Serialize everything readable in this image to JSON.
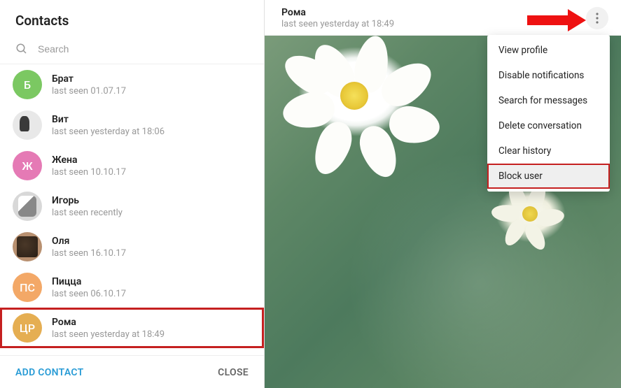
{
  "sidebar": {
    "title": "Contacts",
    "search_placeholder": "Search",
    "contacts": [
      {
        "name": "Брат",
        "status": "last seen 01.07.17",
        "avatar_letter": "Б",
        "avatar_class": "avatar-b"
      },
      {
        "name": "Вит",
        "status": "last seen yesterday at 18:06",
        "avatar_letter": "",
        "avatar_class": "avatar-vit"
      },
      {
        "name": "Жена",
        "status": "last seen 10.10.17",
        "avatar_letter": "Ж",
        "avatar_class": "avatar-zh"
      },
      {
        "name": "Игорь",
        "status": "last seen recently",
        "avatar_letter": "",
        "avatar_class": "avatar-igor"
      },
      {
        "name": "Оля",
        "status": "last seen 16.10.17",
        "avatar_letter": "",
        "avatar_class": "avatar-olya"
      },
      {
        "name": "Пицца",
        "status": "last seen 06.10.17",
        "avatar_letter": "ПС",
        "avatar_class": "avatar-pc"
      },
      {
        "name": "Рома",
        "status": "last seen yesterday at 18:49",
        "avatar_letter": "ЦР",
        "avatar_class": "avatar-cr",
        "highlighted": true
      }
    ],
    "add_contact_label": "ADD CONTACT",
    "close_label": "CLOSE"
  },
  "chat": {
    "title": "Рома",
    "status": "last seen yesterday at 18:49"
  },
  "menu": {
    "items": [
      {
        "label": "View profile"
      },
      {
        "label": "Disable notifications"
      },
      {
        "label": "Search for messages"
      },
      {
        "label": "Delete conversation"
      },
      {
        "label": "Clear history"
      },
      {
        "label": "Block user",
        "highlighted": true
      }
    ]
  }
}
